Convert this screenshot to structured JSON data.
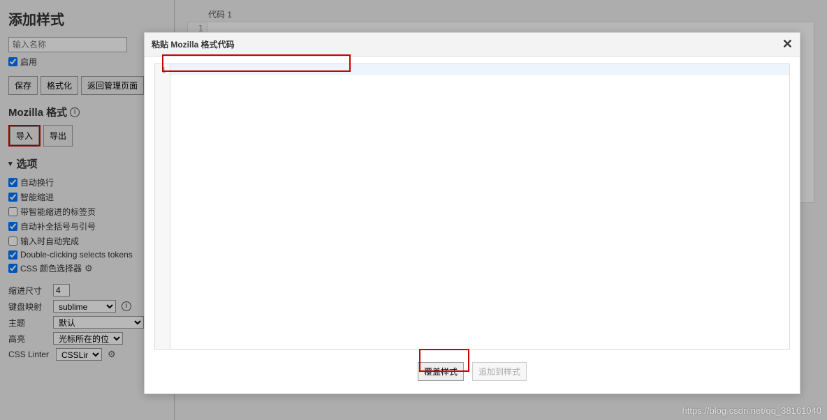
{
  "page": {
    "title": "添加样式"
  },
  "sidebar": {
    "name_placeholder": "输入名称",
    "enable_label": "启用",
    "buttons": {
      "save": "保存",
      "format": "格式化",
      "back": "返回管理页面"
    },
    "mozilla_section": "Mozilla 格式",
    "import": "导入",
    "export": "导出",
    "options_heading": "选项",
    "options": {
      "auto_wrap": "自动换行",
      "smart_indent": "智能缩进",
      "tab_smart_indent": "带智能缩进的标签页",
      "auto_close": "自动补全括号与引号",
      "auto_complete": "输入时自动完成",
      "double_click": "Double-clicking selects tokens",
      "color_picker": "CSS 颜色选择器"
    },
    "form": {
      "indent_label": "缩进尺寸",
      "indent_value": "4",
      "keymap_label": "键盘映射",
      "keymap_value": "sublime",
      "theme_label": "主题",
      "theme_value": "默认",
      "highlight_label": "高亮",
      "highlight_value": "光标所在的位置",
      "lint_label": "CSS Linter",
      "lint_value": "CSSLint"
    }
  },
  "main": {
    "code_title": "代码 1",
    "line_num": "1"
  },
  "modal": {
    "title": "粘贴 Mozilla 格式代码",
    "close": "✕",
    "line_num": "1",
    "overwrite": "覆盖样式",
    "append": "追加到样式"
  },
  "watermark": "https://blog.csdn.net/qq_38161040"
}
